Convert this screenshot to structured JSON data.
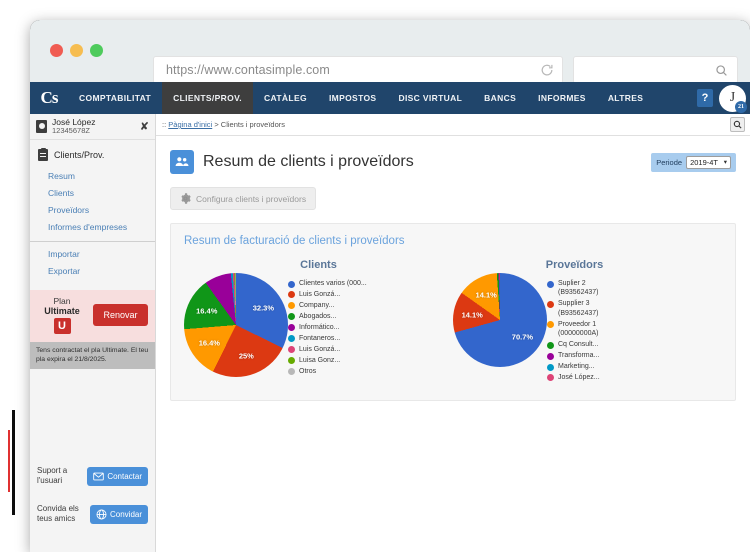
{
  "browser": {
    "url": "https://www.contasimple.com",
    "url_placeholder": "https://www.contasimple.com",
    "search_value": "",
    "search_placeholder": "",
    "reload_icon": "reload-icon",
    "search_icon": "search-icon"
  },
  "topnav": {
    "brand": "Cs",
    "items": [
      {
        "label": "COMPTABILITAT",
        "active": false
      },
      {
        "label": "CLIENTS/PROV.",
        "active": true
      },
      {
        "label": "CATÀLEG",
        "active": false
      },
      {
        "label": "IMPOSTOS",
        "active": false
      },
      {
        "label": "DISC VIRTUAL",
        "active": false
      },
      {
        "label": "BANCS",
        "active": false
      },
      {
        "label": "INFORMES",
        "active": false
      },
      {
        "label": "ALTRES",
        "active": false
      }
    ],
    "help_label": "?",
    "avatar_initial": "J",
    "avatar_badge": "21"
  },
  "sidebar": {
    "user_name": "José López",
    "user_id": "12345678Z",
    "shuffle_icon": "shuffle-icon",
    "section_title": "Clients/Prov.",
    "nav": [
      {
        "label": "Resum"
      },
      {
        "label": "Clients"
      },
      {
        "label": "Proveïdors"
      },
      {
        "label": "Informes d'empreses"
      },
      {
        "label": "Importar"
      },
      {
        "label": "Exportar"
      }
    ],
    "plan": {
      "line1": "Plan",
      "line2": "Ultimate",
      "badge": "U",
      "button": "Renovar",
      "note": "Tens contractat el pla Ultimate. El teu pla expira el 21/8/2025."
    },
    "support": {
      "label": "Suport a l'usuari",
      "button": "Contactar",
      "icon": "envelope-icon"
    },
    "invite": {
      "label": "Convida els teus amics",
      "button": "Convidar",
      "icon": "globe-icon"
    }
  },
  "breadcrumb": {
    "prefix": ":: ",
    "home": "Pàgina d'inici",
    "sep": " > ",
    "current": "Clients i proveïdors",
    "search_icon": "search-icon"
  },
  "page": {
    "icon": "users-icon",
    "title": "Resum de clients i proveïdors",
    "period_label": "Periode",
    "period_value": "2019-4T",
    "config_button": "Configura clients i proveïdors",
    "config_icon": "gear-icon"
  },
  "panel": {
    "title": "Resum de facturació de clients i proveïdors"
  },
  "chart_data": [
    {
      "type": "pie",
      "title": "Clients",
      "legend_position": "right",
      "categories": [
        "Clientes varios (000...",
        "Luis Gonzá...",
        "Company...",
        "Abogados...",
        "Informático...",
        "Fontaneros...",
        "Luis Gonzá...",
        "Luisa Gonz...",
        "Otros"
      ],
      "values": [
        32.3,
        25.0,
        16.4,
        16.4,
        8.3,
        0.6,
        0.5,
        0.3,
        0.2
      ],
      "data_labels": [
        "32.3%",
        "25%",
        "16.4%",
        "16.4%",
        "",
        "",
        "",
        "",
        ""
      ],
      "colors": [
        "#3366cc",
        "#dc3912",
        "#ff9900",
        "#109618",
        "#990099",
        "#0099c6",
        "#dd4477",
        "#66aa00",
        "#b8b8b8"
      ]
    },
    {
      "type": "pie",
      "title": "Proveïdors",
      "legend_position": "right",
      "categories": [
        "Suplier 2\n(B93562437)",
        "Supplier 3\n(B93562437)",
        "Proveedor 1\n(00000000A)",
        "Cq Consult...",
        "Transforma...",
        "Marketing...",
        "José López..."
      ],
      "values": [
        70.7,
        14.1,
        14.1,
        0.6,
        0.3,
        0.1,
        0.1
      ],
      "data_labels": [
        "70.7%",
        "14.1%",
        "14.1%",
        "",
        "",
        "",
        ""
      ],
      "colors": [
        "#3366cc",
        "#dc3912",
        "#ff9900",
        "#109618",
        "#990099",
        "#0099c6",
        "#dd4477"
      ]
    }
  ],
  "colors": {
    "nav_bg": "#20456b",
    "accent_blue": "#4a90d9",
    "panel_title": "#6ba3dd",
    "danger": "#c9302c"
  }
}
